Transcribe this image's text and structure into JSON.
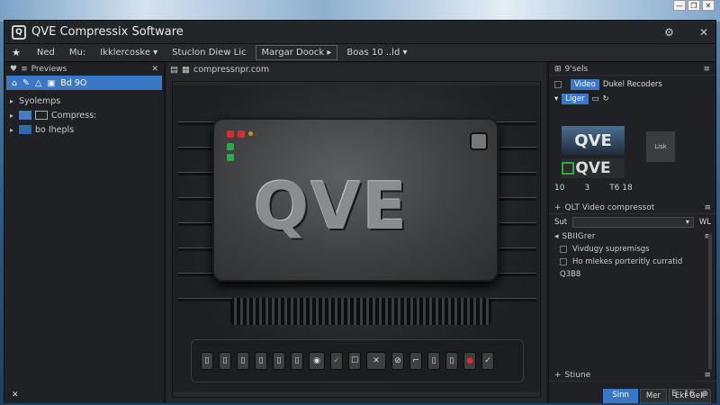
{
  "window": {
    "title": "QVE Compressix Software",
    "title_extras": [
      "⚙",
      "✕"
    ]
  },
  "system_buttons": [
    "—",
    "❐",
    "✕"
  ],
  "menubar": {
    "items": [
      "Ned",
      "Mu:",
      "Ikklercoske ▾",
      "Stuclon Diew Lic",
      "Margar Doock ▸",
      "Boas 10 ..ld ▾"
    ]
  },
  "left_panel": {
    "header": "Previews",
    "close": "✕",
    "toolbar_label": "Bd 9O",
    "sections": [
      {
        "label": "Syolemps",
        "icon": "folder-icon"
      },
      {
        "label": "Compress:",
        "icon": "grid-icon"
      },
      {
        "label": "bo  Ihepls",
        "icon": "image-icon"
      }
    ]
  },
  "center": {
    "tab_label": "compressnpr.com",
    "logo_text": "QVE"
  },
  "right_panel": {
    "header": "9'sels",
    "tabs": [
      "Video",
      "Dukel Recoders"
    ],
    "sub_tab": "Liger",
    "thumb1_text": "QVE",
    "thumb2_text": "QVE",
    "thumb3_text": "Lisk",
    "stats": [
      "10",
      "3",
      "T6 18"
    ],
    "section2_header": "QLT Video compressot",
    "dropdown_label": "Sut",
    "dropdown_value": "WL",
    "section3_header": "SBIIGrer",
    "checkboxes": [
      "Vivdugy supremisgs",
      "Ho mlekes porteritly curratid"
    ],
    "extra_line": "Q3B8",
    "section4_header": "Stiune",
    "buttons": [
      "Sinn",
      "Mer",
      "Ekt Gek"
    ],
    "status_icons": [
      "E",
      "16",
      "⊕"
    ]
  },
  "colors": {
    "accent": "#3c77c6",
    "led_red": "#d03030",
    "led_green": "#2fa84a"
  }
}
